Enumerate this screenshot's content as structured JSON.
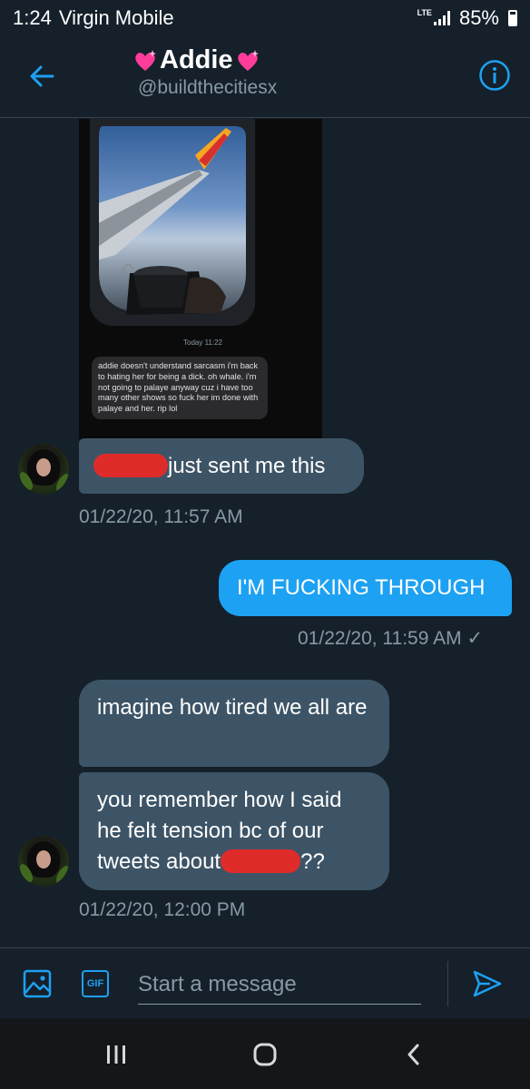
{
  "status_bar": {
    "time": "1:24",
    "carrier": "Virgin Mobile",
    "network": "LTE",
    "battery": "85%",
    "battery_level": 0.85
  },
  "header": {
    "name": "Addie",
    "handle": "@buildthecitiesx",
    "back_icon": "arrow-left-icon",
    "info_icon": "info-icon",
    "accent_color": "#1da1f2"
  },
  "shared_screenshot": {
    "day_label": "Today 11:22",
    "text": "addie doesn't understand sarcasm i'm back to hating her for being a dick. oh whale. i'm not going to palaye anyway cuz i have too many other shows so fuck her im done with palaye and her. rip lol"
  },
  "messages": [
    {
      "direction": "in",
      "text": "just sent me this",
      "redacted": true
    },
    {
      "direction": "in",
      "timestamp": "01/22/20, 11:57 AM"
    },
    {
      "direction": "out",
      "text": "I'M FUCKING THROUGH",
      "timestamp": "01/22/20, 11:59 AM",
      "status": "✓"
    },
    {
      "direction": "in",
      "text": "imagine how tired we all are"
    },
    {
      "direction": "in",
      "text_a": "you remember how I said he felt tension bc of our tweets about",
      "text_b": "??",
      "redacted": true,
      "timestamp": "01/22/20, 12:00 PM"
    }
  ],
  "composer": {
    "placeholder": "Start a message",
    "gif_label": "GIF",
    "image_icon": "image-icon",
    "send_icon": "send-icon"
  },
  "nav_bar": {
    "recents_icon": "recent-apps-icon",
    "home_icon": "home-icon",
    "back_icon": "back-chevron-icon"
  },
  "colors": {
    "background": "#15202b",
    "incoming_bubble": "#3d5466",
    "outgoing_bubble": "#1da1f2",
    "secondary_text": "#8899a6",
    "redaction": "#e02b2b"
  }
}
